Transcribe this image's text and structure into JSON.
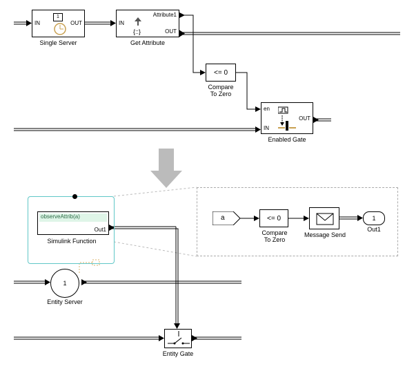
{
  "top": {
    "single_server": {
      "label": "Single Server",
      "in": "IN",
      "out": "OUT",
      "num": "1"
    },
    "get_attribute": {
      "label": "Get Attribute",
      "in": "IN",
      "out": "OUT",
      "attr": "Attribute1"
    },
    "compare_zero": {
      "label": "Compare\nTo Zero",
      "op": "<= 0"
    },
    "enabled_gate": {
      "label": "Enabled Gate",
      "en": "en",
      "in": "IN",
      "out": "OUT"
    }
  },
  "bottom": {
    "simfn": {
      "label": "Simulink Function",
      "sig": "observeAttrib(a)",
      "out": "Out1"
    },
    "server": {
      "label": "Entity Server",
      "num": "1"
    },
    "gate": {
      "label": "Entity Gate"
    },
    "detail": {
      "in": "a",
      "compare": {
        "op": "<= 0",
        "label": "Compare\nTo Zero"
      },
      "send": {
        "label": "Message Send"
      },
      "out": {
        "num": "1",
        "label": "Out1"
      }
    }
  },
  "chart_data": {
    "type": "diagram",
    "title": "Block diagram migration example (old pattern vs new pattern)",
    "top_graph": {
      "blocks": [
        "Single Server",
        "Get Attribute",
        "Compare To Zero",
        "Enabled Gate"
      ],
      "entity_edges": [
        [
          "(in)",
          "Single Server"
        ],
        [
          "Single Server",
          "Get Attribute"
        ],
        [
          "Get Attribute",
          "(out entity line)"
        ],
        [
          "(in lower)",
          "Enabled Gate"
        ],
        [
          "Enabled Gate",
          "(out)"
        ]
      ],
      "signal_edges": [
        [
          "Get Attribute.Attribute1",
          "Compare To Zero"
        ],
        [
          "Compare To Zero",
          "Enabled Gate.en"
        ]
      ]
    },
    "bottom_graph": {
      "blocks": [
        "Simulink Function (observeAttrib(a))",
        "Entity Server",
        "Entity Gate"
      ],
      "entity_edges": [
        [
          "(in)",
          "Entity Server"
        ],
        [
          "Entity Server",
          "(out)"
        ],
        [
          "(in lower)",
          "Entity Gate"
        ],
        [
          "Entity Gate",
          "(out)"
        ]
      ],
      "message_edges": [
        [
          "Simulink Function.Out1",
          "Entity Gate (control)"
        ]
      ],
      "function_detail_chain": [
        "a",
        "Compare To Zero (<= 0)",
        "Message Send",
        "Out1 (1)"
      ]
    }
  }
}
